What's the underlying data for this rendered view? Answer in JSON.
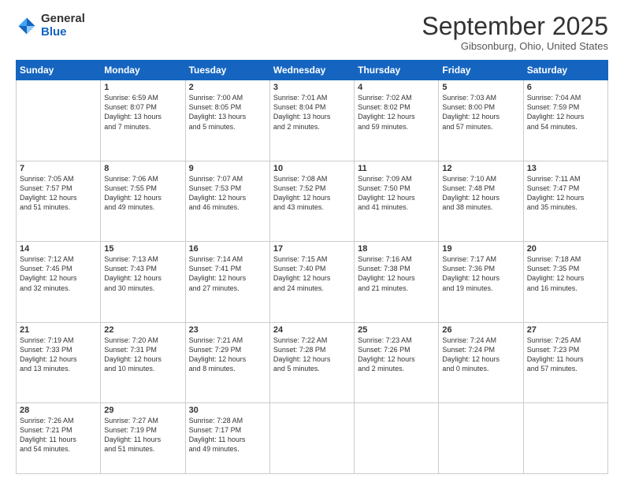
{
  "logo": {
    "general": "General",
    "blue": "Blue"
  },
  "title": "September 2025",
  "location": "Gibsonburg, Ohio, United States",
  "days_of_week": [
    "Sunday",
    "Monday",
    "Tuesday",
    "Wednesday",
    "Thursday",
    "Friday",
    "Saturday"
  ],
  "weeks": [
    [
      {
        "num": "",
        "info": ""
      },
      {
        "num": "1",
        "info": "Sunrise: 6:59 AM\nSunset: 8:07 PM\nDaylight: 13 hours\nand 7 minutes."
      },
      {
        "num": "2",
        "info": "Sunrise: 7:00 AM\nSunset: 8:05 PM\nDaylight: 13 hours\nand 5 minutes."
      },
      {
        "num": "3",
        "info": "Sunrise: 7:01 AM\nSunset: 8:04 PM\nDaylight: 13 hours\nand 2 minutes."
      },
      {
        "num": "4",
        "info": "Sunrise: 7:02 AM\nSunset: 8:02 PM\nDaylight: 12 hours\nand 59 minutes."
      },
      {
        "num": "5",
        "info": "Sunrise: 7:03 AM\nSunset: 8:00 PM\nDaylight: 12 hours\nand 57 minutes."
      },
      {
        "num": "6",
        "info": "Sunrise: 7:04 AM\nSunset: 7:59 PM\nDaylight: 12 hours\nand 54 minutes."
      }
    ],
    [
      {
        "num": "7",
        "info": "Sunrise: 7:05 AM\nSunset: 7:57 PM\nDaylight: 12 hours\nand 51 minutes."
      },
      {
        "num": "8",
        "info": "Sunrise: 7:06 AM\nSunset: 7:55 PM\nDaylight: 12 hours\nand 49 minutes."
      },
      {
        "num": "9",
        "info": "Sunrise: 7:07 AM\nSunset: 7:53 PM\nDaylight: 12 hours\nand 46 minutes."
      },
      {
        "num": "10",
        "info": "Sunrise: 7:08 AM\nSunset: 7:52 PM\nDaylight: 12 hours\nand 43 minutes."
      },
      {
        "num": "11",
        "info": "Sunrise: 7:09 AM\nSunset: 7:50 PM\nDaylight: 12 hours\nand 41 minutes."
      },
      {
        "num": "12",
        "info": "Sunrise: 7:10 AM\nSunset: 7:48 PM\nDaylight: 12 hours\nand 38 minutes."
      },
      {
        "num": "13",
        "info": "Sunrise: 7:11 AM\nSunset: 7:47 PM\nDaylight: 12 hours\nand 35 minutes."
      }
    ],
    [
      {
        "num": "14",
        "info": "Sunrise: 7:12 AM\nSunset: 7:45 PM\nDaylight: 12 hours\nand 32 minutes."
      },
      {
        "num": "15",
        "info": "Sunrise: 7:13 AM\nSunset: 7:43 PM\nDaylight: 12 hours\nand 30 minutes."
      },
      {
        "num": "16",
        "info": "Sunrise: 7:14 AM\nSunset: 7:41 PM\nDaylight: 12 hours\nand 27 minutes."
      },
      {
        "num": "17",
        "info": "Sunrise: 7:15 AM\nSunset: 7:40 PM\nDaylight: 12 hours\nand 24 minutes."
      },
      {
        "num": "18",
        "info": "Sunrise: 7:16 AM\nSunset: 7:38 PM\nDaylight: 12 hours\nand 21 minutes."
      },
      {
        "num": "19",
        "info": "Sunrise: 7:17 AM\nSunset: 7:36 PM\nDaylight: 12 hours\nand 19 minutes."
      },
      {
        "num": "20",
        "info": "Sunrise: 7:18 AM\nSunset: 7:35 PM\nDaylight: 12 hours\nand 16 minutes."
      }
    ],
    [
      {
        "num": "21",
        "info": "Sunrise: 7:19 AM\nSunset: 7:33 PM\nDaylight: 12 hours\nand 13 minutes."
      },
      {
        "num": "22",
        "info": "Sunrise: 7:20 AM\nSunset: 7:31 PM\nDaylight: 12 hours\nand 10 minutes."
      },
      {
        "num": "23",
        "info": "Sunrise: 7:21 AM\nSunset: 7:29 PM\nDaylight: 12 hours\nand 8 minutes."
      },
      {
        "num": "24",
        "info": "Sunrise: 7:22 AM\nSunset: 7:28 PM\nDaylight: 12 hours\nand 5 minutes."
      },
      {
        "num": "25",
        "info": "Sunrise: 7:23 AM\nSunset: 7:26 PM\nDaylight: 12 hours\nand 2 minutes."
      },
      {
        "num": "26",
        "info": "Sunrise: 7:24 AM\nSunset: 7:24 PM\nDaylight: 12 hours\nand 0 minutes."
      },
      {
        "num": "27",
        "info": "Sunrise: 7:25 AM\nSunset: 7:23 PM\nDaylight: 11 hours\nand 57 minutes."
      }
    ],
    [
      {
        "num": "28",
        "info": "Sunrise: 7:26 AM\nSunset: 7:21 PM\nDaylight: 11 hours\nand 54 minutes."
      },
      {
        "num": "29",
        "info": "Sunrise: 7:27 AM\nSunset: 7:19 PM\nDaylight: 11 hours\nand 51 minutes."
      },
      {
        "num": "30",
        "info": "Sunrise: 7:28 AM\nSunset: 7:17 PM\nDaylight: 11 hours\nand 49 minutes."
      },
      {
        "num": "",
        "info": ""
      },
      {
        "num": "",
        "info": ""
      },
      {
        "num": "",
        "info": ""
      },
      {
        "num": "",
        "info": ""
      }
    ]
  ]
}
